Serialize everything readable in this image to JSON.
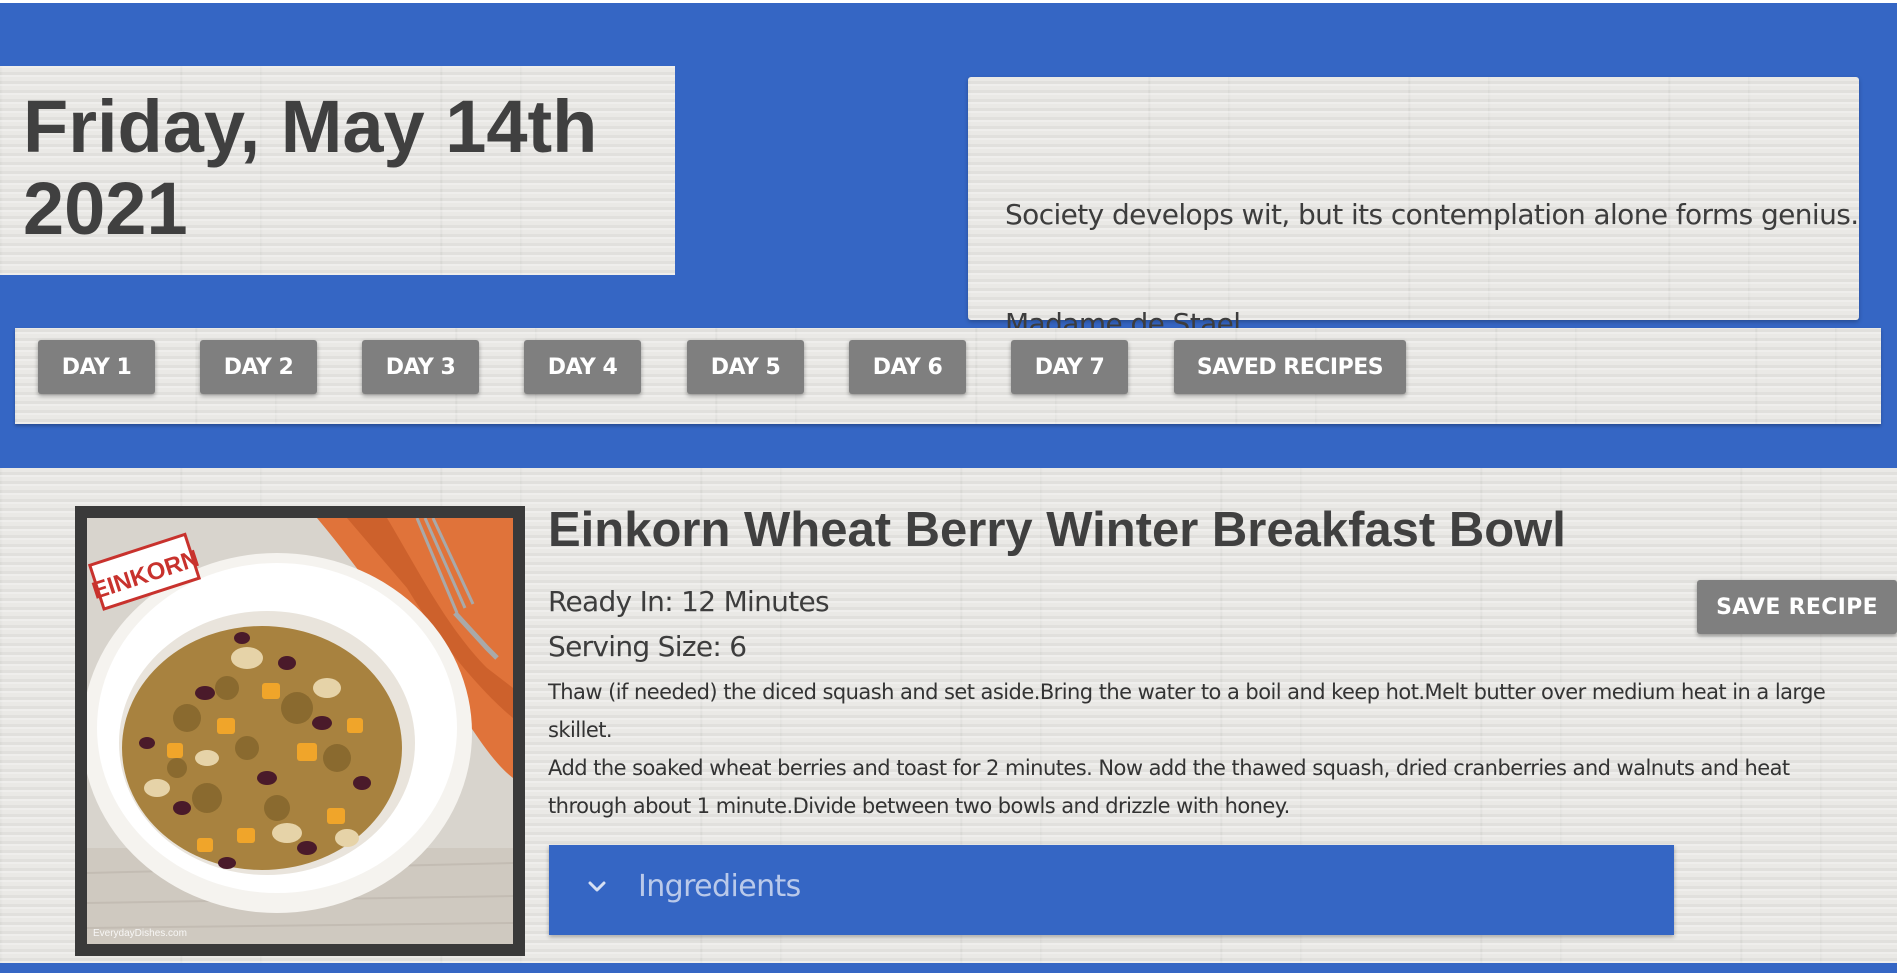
{
  "header": {
    "date_line1": "Friday, May 14th",
    "date_line2": "2021"
  },
  "quote": {
    "text": "Society develops wit, but its contemplation alone forms genius.",
    "author": "Madame de Stael"
  },
  "nav": {
    "buttons": [
      "DAY 1",
      "DAY 2",
      "DAY 3",
      "DAY 4",
      "DAY 5",
      "DAY 6",
      "DAY 7",
      "SAVED RECIPES"
    ]
  },
  "recipe": {
    "title": "Einkorn Wheat Berry Winter Breakfast Bowl",
    "ready_in": "Ready In: 12 Minutes",
    "serving_size": "Serving Size: 6",
    "steps_1": "Thaw (if needed) the diced squash and set aside.Bring the water to a boil and keep hot.Melt butter over medium heat in a large skillet.",
    "steps_2": "Add the soaked wheat berries and toast for 2 minutes. Now add the thawed squash, dried cranberries and walnuts and heat through about 1 minute.Divide between two bowls and drizzle with honey.",
    "save_label": "SAVE RECIPE",
    "ingredients_label": "Ingredients",
    "image": {
      "stamp_text": "EINKORN",
      "watermark": "EverydayDishes.com"
    }
  },
  "colors": {
    "brand_blue": "#3566c4",
    "button_gray": "#7f7f7f",
    "text_dark": "#404040"
  },
  "icons": {
    "ingredients_toggle": "chevron-down-icon"
  }
}
